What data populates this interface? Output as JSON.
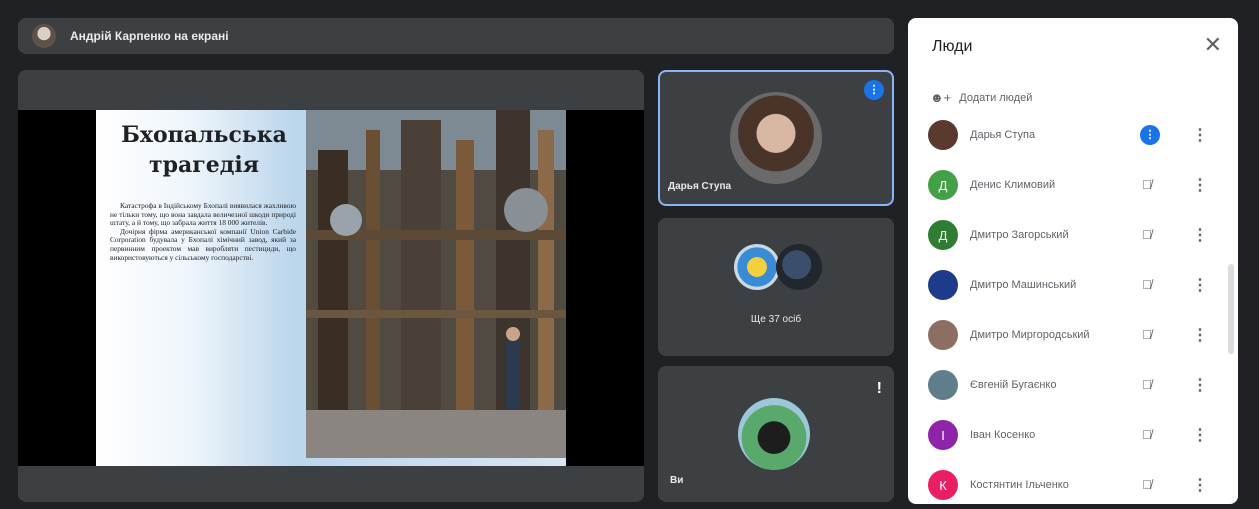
{
  "presenter_bar": {
    "label": "Андрій Карпенко на екрані"
  },
  "slide": {
    "title": "Бхопальська трагедія",
    "paragraphs": [
      "Катастрофа в Індійському Бхопалі виявилася жахливою не тільки тому, що вона завдала величезної шкоди природі штату, а й тому, що забрала життя 18 000 жителів.",
      "Дочірня фірма американської компанії Union Carbide Corporation будувала у Бхопалі хімічний завод, який за первинним проектом мав виробляти пестициди, що використовуються у сільському господарстві."
    ]
  },
  "tiles": {
    "speaker_name": "Дарья Ступа",
    "others_label": "Ще 37 осіб",
    "you_label": "Ви"
  },
  "people_panel": {
    "title": "Люди",
    "add_label": "Додати людей",
    "people": [
      {
        "name": "Дарья Ступа",
        "initial": "",
        "avatar_color": "#5b3a2e",
        "speaking": true
      },
      {
        "name": "Денис Климовий",
        "initial": "Д",
        "avatar_color": "#43a047",
        "speaking": false
      },
      {
        "name": "Дмитро Загорський",
        "initial": "Д",
        "avatar_color": "#2e7d32",
        "speaking": false
      },
      {
        "name": "Дмитро Машинський",
        "initial": "",
        "avatar_color": "#1e3a8a",
        "speaking": false
      },
      {
        "name": "Дмитро Миргородський",
        "initial": "",
        "avatar_color": "#8d6e63",
        "speaking": false
      },
      {
        "name": "Євгеній Бугаєнко",
        "initial": "",
        "avatar_color": "#607d8b",
        "speaking": false
      },
      {
        "name": "Іван Косенко",
        "initial": "І",
        "avatar_color": "#8e24aa",
        "speaking": false
      },
      {
        "name": "Костянтин Ільченко",
        "initial": "К",
        "avatar_color": "#e91e63",
        "speaking": false
      }
    ]
  },
  "colors": {
    "accent": "#8ab4f8",
    "speaking": "#1a73e8",
    "background": "#202124"
  },
  "icons": [
    "close-icon",
    "add-person-icon",
    "mic-off-icon",
    "kebab-menu-icon",
    "speaking-indicator-icon"
  ]
}
